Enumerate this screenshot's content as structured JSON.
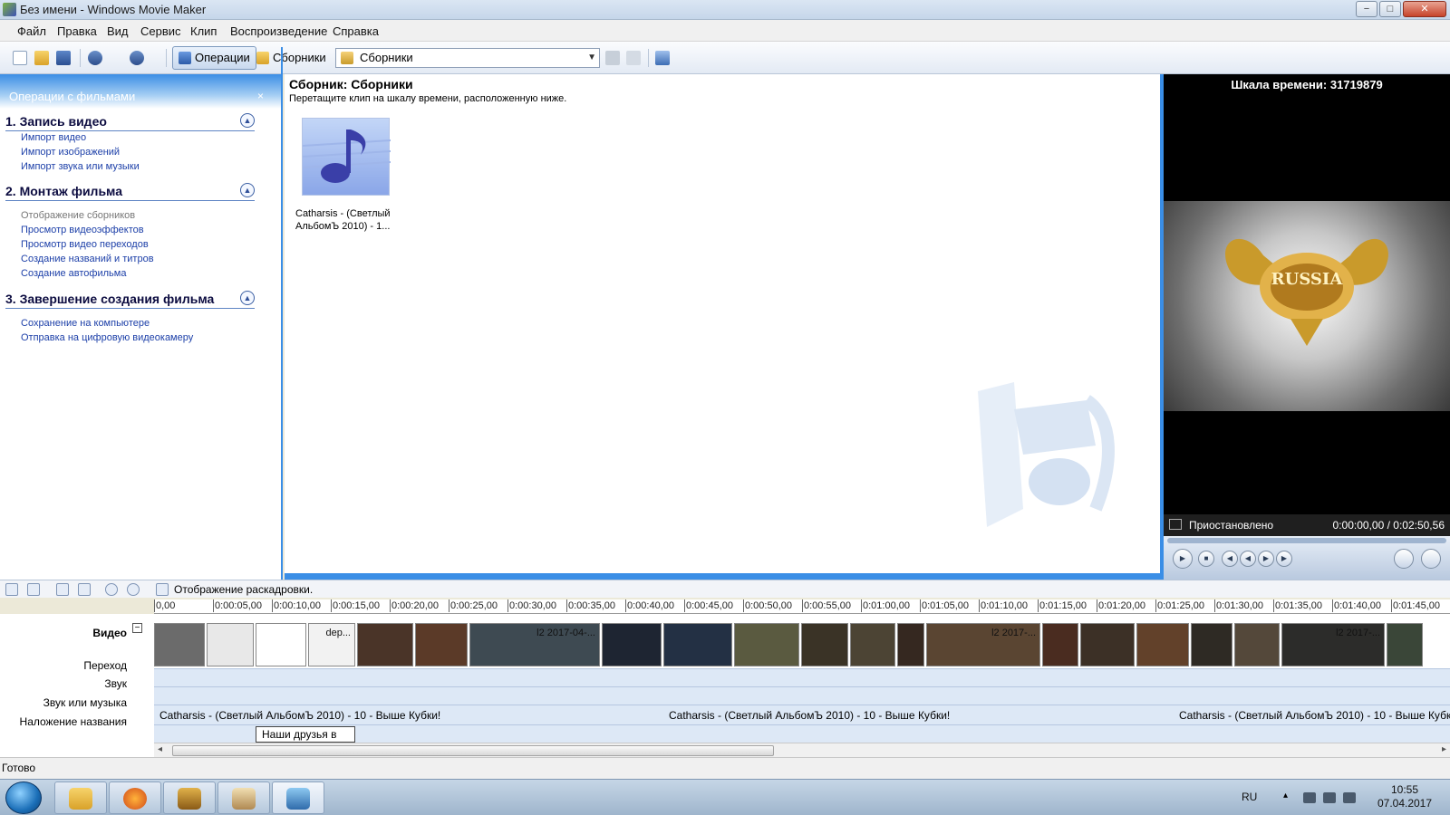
{
  "window": {
    "title": "Без имени - Windows Movie Maker",
    "buttons": [
      "−",
      "□",
      "✕"
    ]
  },
  "menu": [
    "Файл",
    "Правка",
    "Вид",
    "Сервис",
    "Клип",
    "Воспроизведение",
    "Справка"
  ],
  "toolbar": {
    "operations_label": "Операции",
    "collections_label": "Сборники",
    "collection_combo_value": "Сборники",
    "combo_arrow": "▼",
    "icons": [
      "new-icon",
      "open-icon",
      "save-icon",
      "undo-icon",
      "redo-icon",
      "up-folder-icon",
      "new-collection-icon",
      "view-options-icon"
    ]
  },
  "tasks": {
    "header": "Операции с фильмами",
    "close": "×",
    "sections": [
      {
        "title": "1. Запись видео",
        "links": [
          {
            "text": "Импорт видео",
            "disabled": false
          },
          {
            "text": "Импорт изображений",
            "disabled": false
          },
          {
            "text": "Импорт звука или музыки",
            "disabled": false
          }
        ]
      },
      {
        "title": "2. Монтаж фильма",
        "links": [
          {
            "text": "Отображение сборников",
            "disabled": true
          },
          {
            "text": "Просмотр видеоэффектов",
            "disabled": false
          },
          {
            "text": "Просмотр видео переходов",
            "disabled": false
          },
          {
            "text": "Создание названий и титров",
            "disabled": false
          },
          {
            "text": "Создание автофильма",
            "disabled": false
          }
        ]
      },
      {
        "title": "3. Завершение создания фильма",
        "links": [
          {
            "text": "Сохранение на компьютере",
            "disabled": false
          },
          {
            "text": "Отправка на цифровую видеокамеру",
            "disabled": false
          }
        ]
      }
    ]
  },
  "collection": {
    "title": "Сборник: Сборники",
    "hint": "Перетащите клип на шкалу времени, расположенную ниже.",
    "clip_caption_line1": "Catharsis - (Светлый",
    "clip_caption_line2": "АльбомЪ 2010) - 1..."
  },
  "monitor": {
    "title": "Шкала времени: 31719879",
    "status": "Приостановлено",
    "time": "0:00:00,00 / 0:02:50,56",
    "video_text": "RUSSIA"
  },
  "timeline": {
    "mode_label": "Отображение раскадровки.",
    "ruler": [
      "0,00",
      "0:00:05,00",
      "0:00:10,00",
      "0:00:15,00",
      "0:00:20,00",
      "0:00:25,00",
      "0:00:30,00",
      "0:00:35,00",
      "0:00:40,00",
      "0:00:45,00",
      "0:00:50,00",
      "0:00:55,00",
      "0:01:00,00",
      "0:01:05,00",
      "0:01:10,00",
      "0:01:15,00",
      "0:01:20,00",
      "0:01:25,00",
      "0:01:30,00",
      "0:01:35,00",
      "0:01:40,00",
      "0:01:45,00"
    ],
    "tracks": {
      "video": "Видео",
      "video_toggle": "−",
      "transition": "Переход",
      "audio": "Звук",
      "music": "Звук или музыка",
      "title_overlay": "Наложение названия"
    },
    "video_clips": [
      {
        "label": "",
        "color": "#6b6b6b"
      },
      {
        "label": "",
        "color": "#e8e8e8"
      },
      {
        "label": "",
        "color": "#ffffff"
      },
      {
        "label": "dep...",
        "color": "#f2f2f2"
      },
      {
        "label": "",
        "color": "#4a3428"
      },
      {
        "label": "",
        "color": "#5b3a28"
      },
      {
        "label": "l2 2017-04-...",
        "color": "#3e4a52"
      },
      {
        "label": "",
        "color": "#1e2532"
      },
      {
        "label": "",
        "color": "#233044"
      },
      {
        "label": "",
        "color": "#5a5a40"
      },
      {
        "label": "",
        "color": "#3a3326"
      },
      {
        "label": "",
        "color": "#4c4434"
      },
      {
        "label": "",
        "color": "#352820"
      },
      {
        "label": "l2 2017-...",
        "color": "#5a4532"
      },
      {
        "label": "",
        "color": "#4a2c20"
      },
      {
        "label": "",
        "color": "#3c3026"
      },
      {
        "label": "",
        "color": "#62412a"
      },
      {
        "label": "",
        "color": "#2e2a24"
      },
      {
        "label": "",
        "color": "#54483a"
      },
      {
        "label": "l2 2017-...",
        "color": "#2c2c2a"
      },
      {
        "label": "",
        "color": "#3a4638"
      }
    ],
    "music_label": "Catharsis - (Светлый АльбомЪ 2010) - 10 - Выше Кубки!",
    "title_clip": "Наши друзья в Li...",
    "scroll_left": "◂",
    "scroll_right": "▸"
  },
  "status": "Готово",
  "taskbar": {
    "apps": [
      "explorer-icon",
      "firefox-icon",
      "game-launcher-icon",
      "game-character-icon",
      "movie-maker-icon"
    ],
    "lang": "RU",
    "tray_arrow": "▴",
    "time": "10:55",
    "date": "07.04.2017"
  }
}
